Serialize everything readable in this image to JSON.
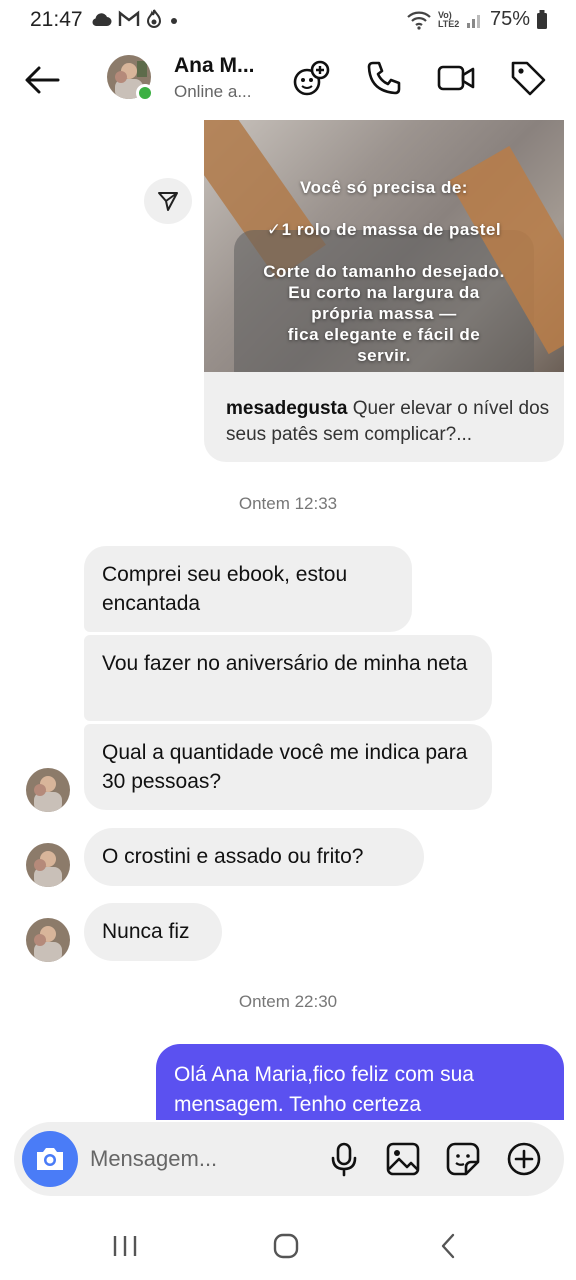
{
  "status_bar": {
    "time": "21:47",
    "battery": "75%",
    "network_label": "Vo) LTE2"
  },
  "header": {
    "contact_name": "Ana M...",
    "contact_status": "Online a...",
    "online_color": "#3cb043"
  },
  "shared_post": {
    "image_lines": [
      "Você só precisa de:",
      "✓1 rolo de massa de pastel",
      "Corte do tamanho desejado.",
      "Eu corto na largura da",
      "própria massa —",
      "fica elegante e fácil de",
      "servir."
    ],
    "username": "mesadegusta",
    "caption": "Quer elevar o nível dos seus patês sem complicar?..."
  },
  "timestamps": [
    "Ontem 12:33",
    "Ontem 22:30"
  ],
  "messages_in": [
    "Comprei seu ebook, estou encantada",
    "Vou fazer no aniversário de minha neta",
    "Qual a quantidade você me indica para 30 pessoas?",
    "O crostini e assado ou frito?",
    "Nunca fiz"
  ],
  "message_out": "Olá Ana Maria,fico feliz com sua mensagem. Tenho certeza",
  "composer": {
    "placeholder": "Mensagem...",
    "accent_color": "#4a7cf7"
  },
  "colors": {
    "outgoing_bubble": "#5b51f0",
    "incoming_bubble": "#efefef"
  }
}
